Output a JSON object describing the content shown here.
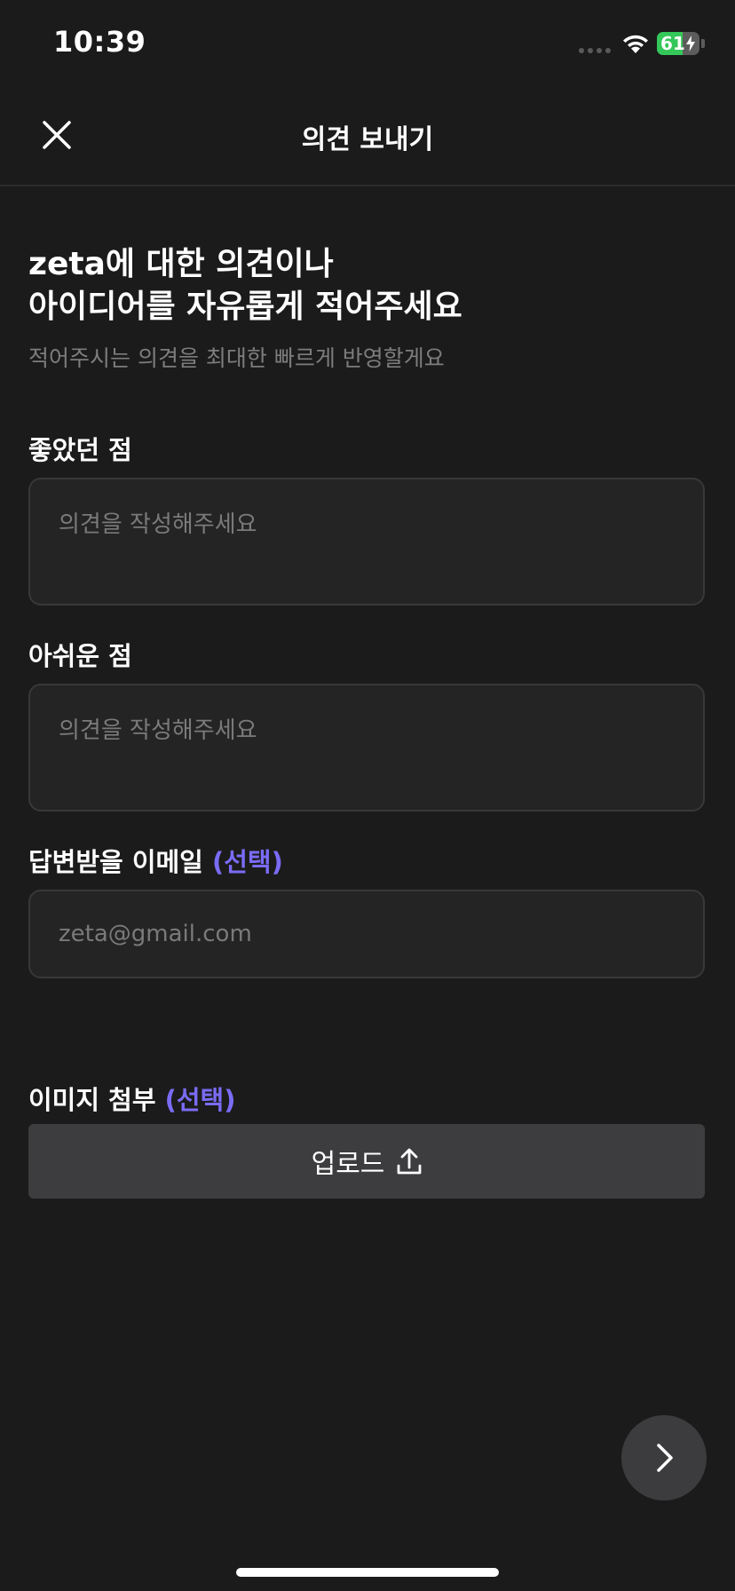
{
  "status_bar": {
    "time": "10:39",
    "battery_level": "61",
    "battery_fraction": 0.61
  },
  "nav": {
    "title": "의견 보내기",
    "close_icon": "close-icon"
  },
  "intro": {
    "headline_line1": "zeta에 대한 의견이나",
    "headline_line2": "아이디어를 자유롭게 적어주세요",
    "subtext": "적어주시는 의견을 최대한 빠르게 반영할게요"
  },
  "form": {
    "liked": {
      "label": "좋았던 점",
      "placeholder": "의견을 작성해주세요",
      "value": ""
    },
    "disliked": {
      "label": "아쉬운 점",
      "placeholder": "의견을 작성해주세요",
      "value": ""
    },
    "email": {
      "label": "답변받을 이메일",
      "optional": "(선택)",
      "placeholder": "zeta@gmail.com",
      "value": ""
    },
    "image": {
      "label": "이미지 첨부",
      "optional": "(선택)",
      "upload_label": "업로드",
      "upload_icon": "upload-icon"
    }
  },
  "next_button": {
    "icon": "chevron-right-icon"
  },
  "colors": {
    "background": "#1b1b1b",
    "accent": "#7b6cf6",
    "input_bg": "#242424",
    "button_bg": "#3d3d3f",
    "battery_green": "#34c759"
  }
}
